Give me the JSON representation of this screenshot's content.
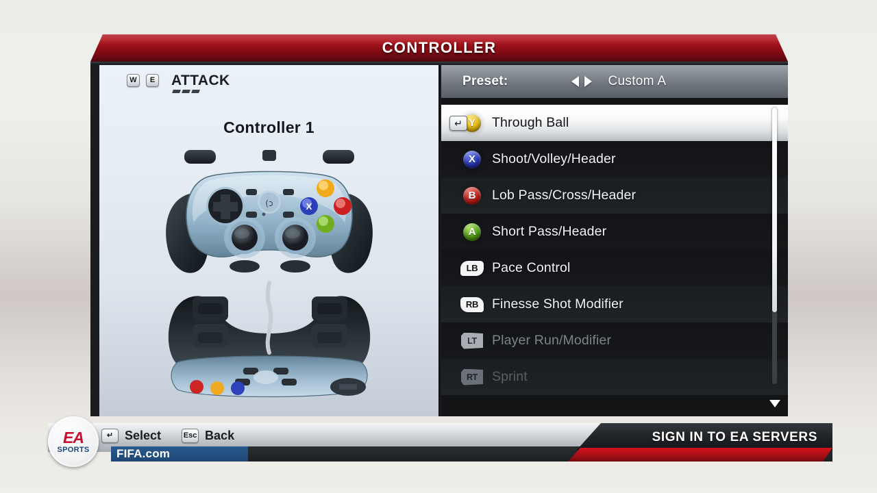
{
  "window": {
    "title": "CONTROLLER"
  },
  "left_panel": {
    "key_prev": "W",
    "key_next": "E",
    "section_label": "ATTACK",
    "controller_title": "Controller 1",
    "gamepad_alt": "logitech-gamepad"
  },
  "preset": {
    "label": "Preset:",
    "prev_arrow": "left-arrow-icon",
    "next_arrow": "right-arrow-icon",
    "value": "Custom A"
  },
  "bindings": [
    {
      "button": "Y",
      "type": "face",
      "label": "Through Ball",
      "selected": true,
      "state": "normal",
      "enter_key": "↵"
    },
    {
      "button": "X",
      "type": "face",
      "label": "Shoot/Volley/Header",
      "selected": false,
      "state": "normal"
    },
    {
      "button": "B",
      "type": "face",
      "label": "Lob Pass/Cross/Header",
      "selected": false,
      "state": "normal"
    },
    {
      "button": "A",
      "type": "face",
      "label": "Short Pass/Header",
      "selected": false,
      "state": "normal"
    },
    {
      "button": "LB",
      "type": "bumper",
      "label": "Pace Control",
      "selected": false,
      "state": "normal"
    },
    {
      "button": "RB",
      "type": "bumper",
      "label": "Finesse Shot Modifier",
      "selected": false,
      "state": "normal"
    },
    {
      "button": "LT",
      "type": "trigger",
      "label": "Player Run/Modifier",
      "selected": false,
      "state": "dim"
    },
    {
      "button": "RT",
      "type": "trigger",
      "label": "Sprint",
      "selected": false,
      "state": "dimmer"
    }
  ],
  "scrollbar": {
    "thumb_percent": 74,
    "down_arrow": "chevron-down-icon"
  },
  "footer": {
    "select_key": "↵",
    "select_label": "Select",
    "back_key": "Esc",
    "back_label": "Back",
    "brand_top": "EA",
    "brand_bottom": "SPORTS",
    "site": "FIFA.com",
    "signin_label": "SIGN IN TO EA SERVERS"
  },
  "colors": {
    "title_red": "#b3121c",
    "accent_red": "#c8102e",
    "button_y": "#e8b806",
    "button_x": "#2433b8",
    "button_b": "#c01912",
    "button_a": "#4f9c10",
    "panel_light": "#e6edf4",
    "panel_dark": "#121416"
  }
}
